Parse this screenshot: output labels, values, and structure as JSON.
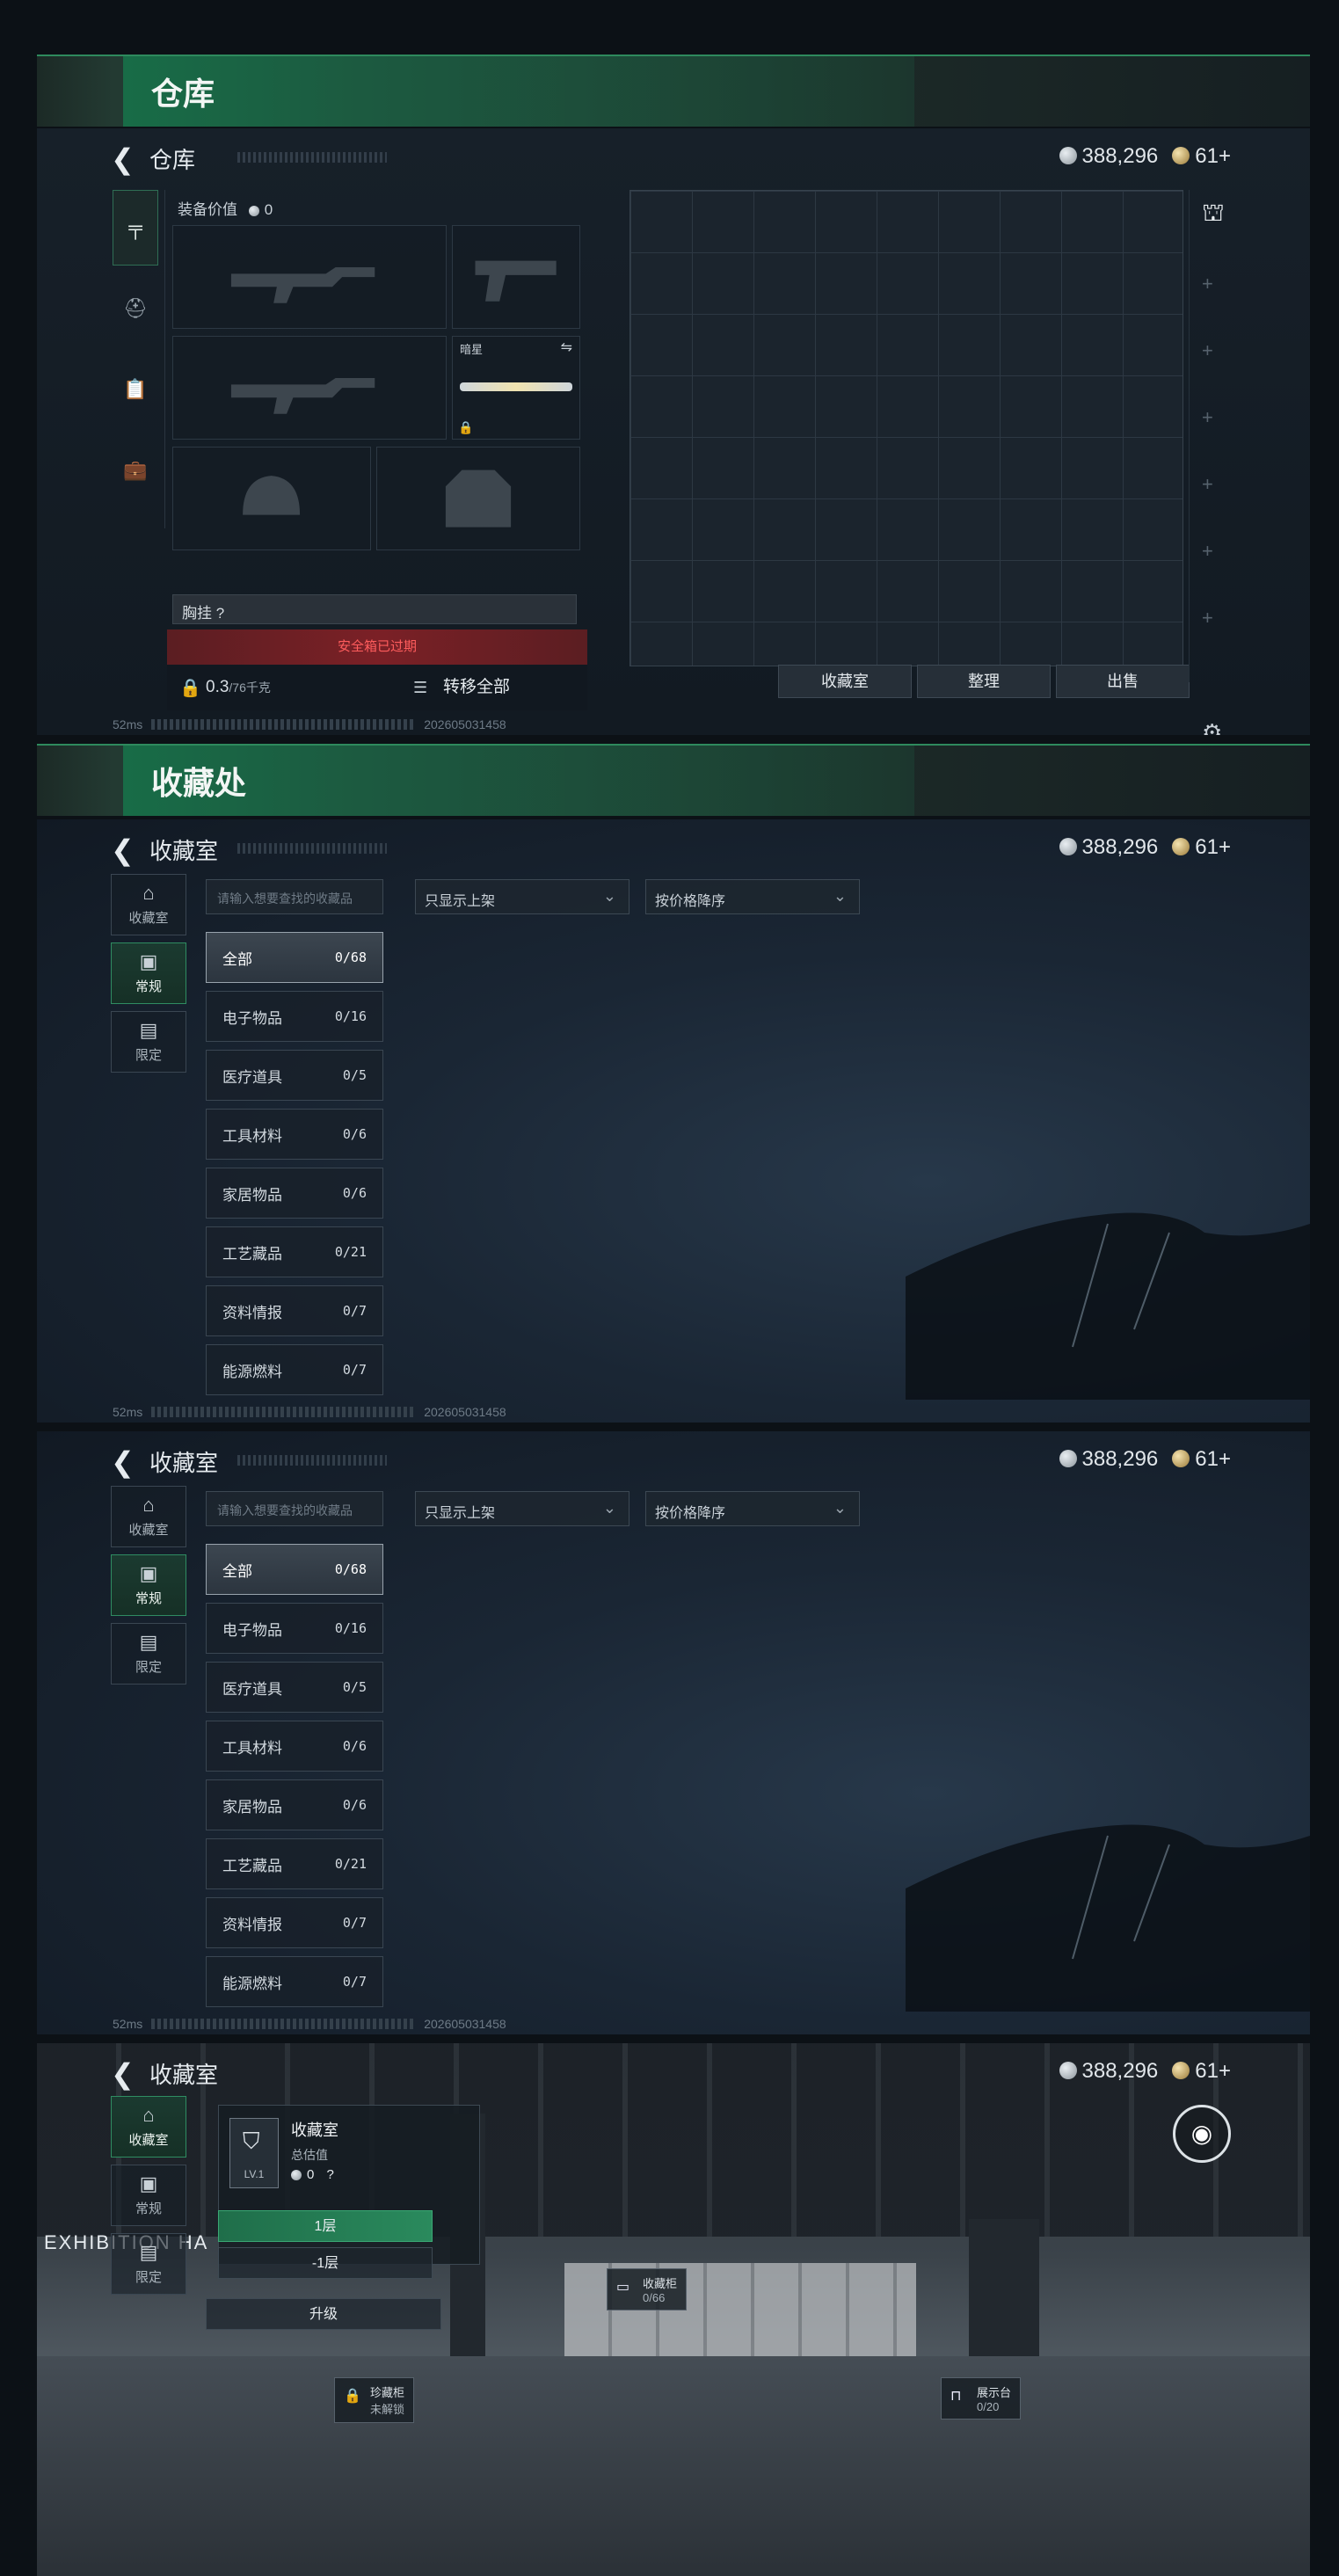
{
  "currency": {
    "silver": "388,296",
    "gold": "61+"
  },
  "status": {
    "ping": "52ms",
    "build": "202605031458"
  },
  "section1": {
    "heading": "仓库"
  },
  "warehouse": {
    "title": "仓库",
    "equip_value_label": "装备价值",
    "equip_value": "0",
    "secondary_slot_label": "暗星",
    "chest_label": "胸挂 ?",
    "safe_box_text": "安全箱已过期",
    "capacity": "0.3",
    "capacity_max": "/76千克",
    "transfer_all": "转移全部",
    "buttons": [
      "收藏室",
      "整理",
      "出售"
    ]
  },
  "section2": {
    "heading": "收藏处"
  },
  "collection": {
    "title": "收藏室",
    "search_placeholder": "请输入想要查找的收藏品",
    "filter": "只显示上架",
    "sort": "按价格降序",
    "tabs": [
      "收藏室",
      "常规",
      "限定"
    ],
    "categories": [
      {
        "name": "全部",
        "count": "0/68"
      },
      {
        "name": "电子物品",
        "count": "0/16"
      },
      {
        "name": "医疗道具",
        "count": "0/5"
      },
      {
        "name": "工具材料",
        "count": "0/6"
      },
      {
        "name": "家居物品",
        "count": "0/6"
      },
      {
        "name": "工艺藏品",
        "count": "0/21"
      },
      {
        "name": "资料情报",
        "count": "0/7"
      },
      {
        "name": "能源燃料",
        "count": "0/7"
      }
    ]
  },
  "room": {
    "title": "收藏室",
    "card_name": "收藏室",
    "card_sub": "总估值",
    "card_value": "0",
    "card_q": "?",
    "level": "LV.1",
    "floor1": "1层",
    "floor2": "-1层",
    "upgrade": "升级",
    "tabs": [
      "收藏室",
      "常规",
      "限定"
    ],
    "wall_text": "EXHIBITION HA",
    "tag_cabinet": {
      "name": "收藏柜",
      "value": "0/66"
    },
    "tag_locker": {
      "name": "珍藏柜",
      "value": "未解锁"
    },
    "tag_display": {
      "name": "展示台",
      "value": "0/20"
    }
  }
}
